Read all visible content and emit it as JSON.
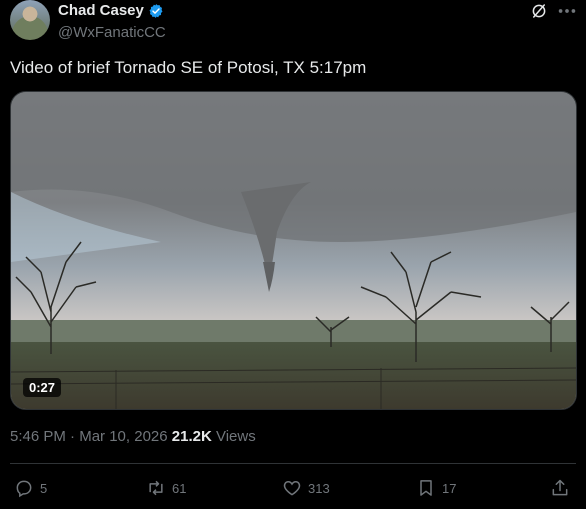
{
  "author": {
    "name": "Chad Casey",
    "handle": "@WxFanaticCC"
  },
  "tweet": {
    "text": "Video of brief Tornado SE of Potosi, TX 5:17pm"
  },
  "media": {
    "duration": "0:27"
  },
  "meta": {
    "time": "5:46 PM",
    "separator": " · ",
    "date": "Mar 10, 2026",
    "views_count": "21.2K",
    "views_label": " Views"
  },
  "actions": {
    "replies": "5",
    "reposts": "61",
    "likes": "313",
    "bookmarks": "17"
  },
  "colors": {
    "background": "#000000",
    "text": "#e7e9ea",
    "muted": "#71767b",
    "verified": "#1d9bf0"
  },
  "icons": [
    "verified-badge-icon",
    "grok-icon",
    "more-icon",
    "reply-icon",
    "repost-icon",
    "like-icon",
    "bookmark-icon",
    "share-icon"
  ]
}
